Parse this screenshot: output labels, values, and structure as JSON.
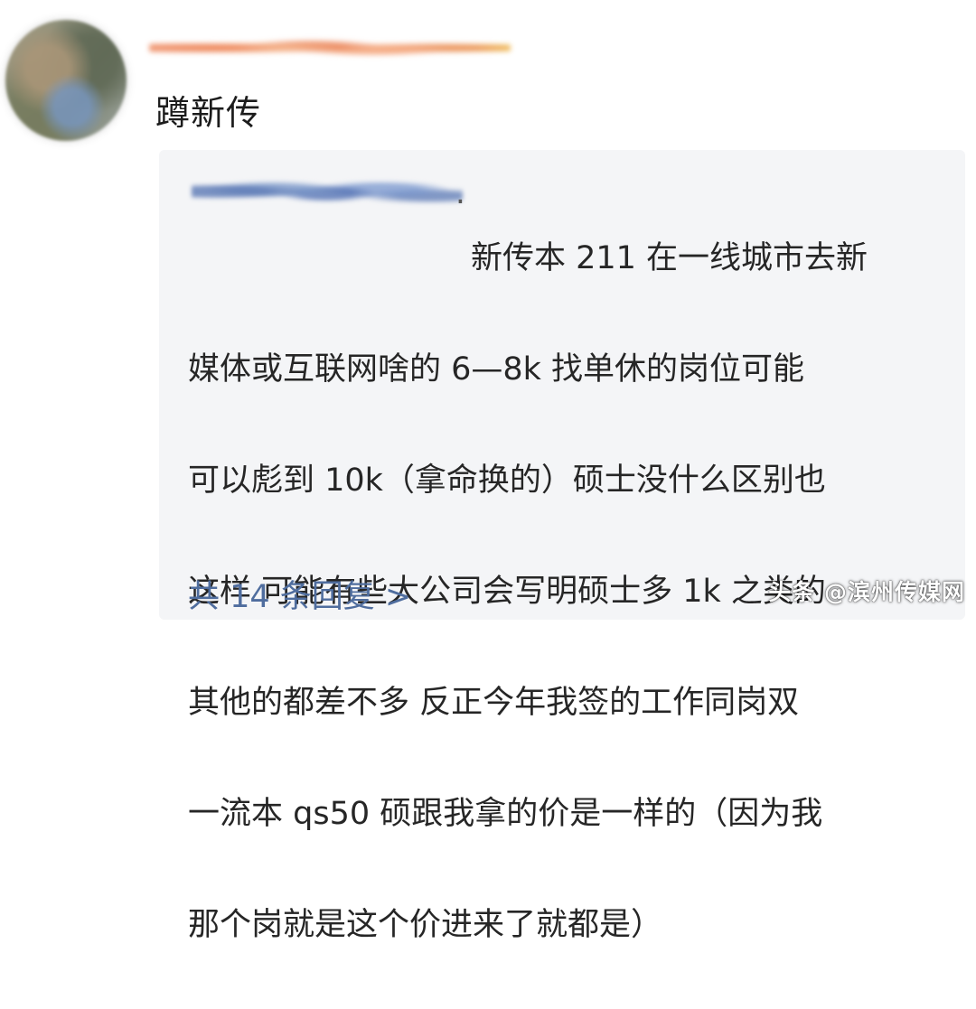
{
  "post": {
    "text": "蹲新传"
  },
  "reply": {
    "lines": [
      "新传本 211 在一线城市去新",
      "媒体或互联网啥的 6—8k  找单休的岗位可能",
      "可以彪到 10k（拿命换的）硕士没什么区别也",
      "这样 可能有些大公司会写明硕士多 1k 之类的",
      "其他的都差不多 反正今年我签的工作同岗双",
      "一流本 qs50 硕跟我拿的价是一样的（因为我",
      "那个岗就是这个价进来了就都是）"
    ],
    "more_replies": "共 14 条回复 >"
  },
  "watermark": "头条 @滨州传媒网"
}
